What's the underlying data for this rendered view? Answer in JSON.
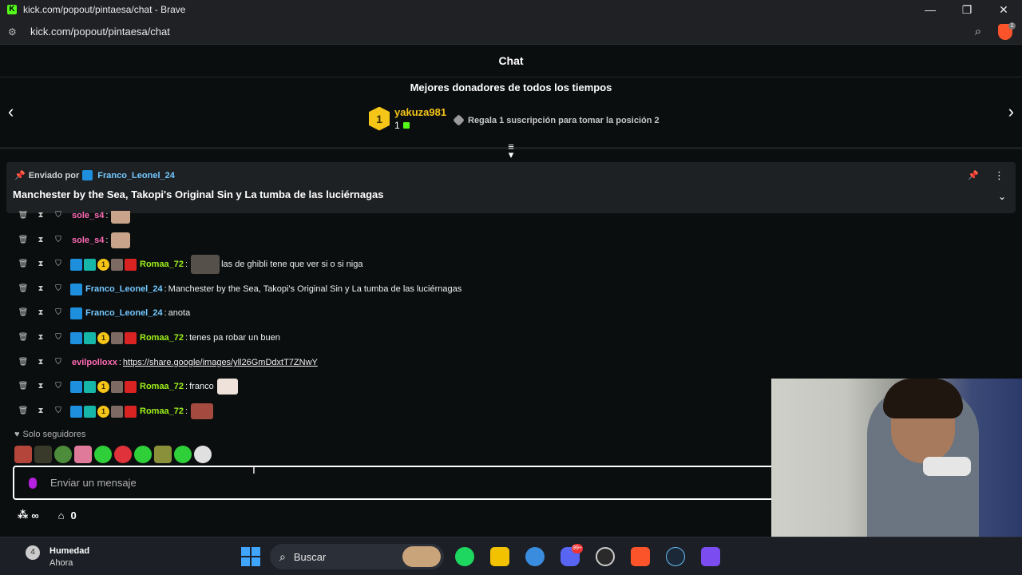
{
  "browser": {
    "title": "kick.com/popout/pintaesa/chat - Brave",
    "url": "kick.com/popout/pintaesa/chat",
    "shield_count": "1"
  },
  "chat": {
    "title": "Chat"
  },
  "donors": {
    "title": "Mejores donadores de todos los tiempos",
    "top_rank": "1",
    "top_name": "yakuza981",
    "top_count": "1",
    "gift_hint": "Regala 1 suscripción para tomar la posición 2"
  },
  "pinned": {
    "sent_by_label": "Enviado por",
    "sent_by_user": "Franco_Leonel_24",
    "text": "Manchester by the Sea, Takopi's Original Sin y La tumba de las luciérnagas"
  },
  "messages": [
    {
      "user": "sole_s4",
      "sep": ":",
      "text": "",
      "link": ""
    },
    {
      "user": "sole_s4",
      "sep": ":",
      "text": "",
      "link": ""
    },
    {
      "user": "Romaa_72",
      "sep": ":",
      "text": "las de ghibli tene que ver si o si niga",
      "link": ""
    },
    {
      "user": "Franco_Leonel_24",
      "sep": ":",
      "text": "Manchester by the Sea, Takopi's Original Sin y La tumba de las luciérnagas",
      "link": ""
    },
    {
      "user": "Franco_Leonel_24",
      "sep": ":",
      "text": "anota",
      "link": ""
    },
    {
      "user": "Romaa_72",
      "sep": ":",
      "text": "tenes pa robar un buen",
      "link": ""
    },
    {
      "user": "evilpolloxx",
      "sep": ":",
      "text": "",
      "link": "https://share.google/images/yll26GmDdxtT7ZNwY"
    },
    {
      "user": "Romaa_72",
      "sep": ":",
      "text": "franco",
      "link": ""
    },
    {
      "user": "Romaa_72",
      "sep": ":",
      "text": "",
      "link": ""
    }
  ],
  "badge_numbers": {
    "gold": "1"
  },
  "followers_only": "Solo seguidores",
  "input": {
    "placeholder": "Enviar un mensaje"
  },
  "footer": {
    "points_value": "∞",
    "store_value": "0"
  },
  "taskbar": {
    "weather_badge": "4",
    "weather_title": "Humedad",
    "weather_sub": "Ahora",
    "search_label": "Buscar",
    "discord_badge": "99+"
  },
  "colors": {
    "kick_green": "#53fc18",
    "gold": "#f5c518",
    "user_pink": "#ff6bb5",
    "user_green": "#9ef01a",
    "user_blue": "#73c8ff"
  }
}
